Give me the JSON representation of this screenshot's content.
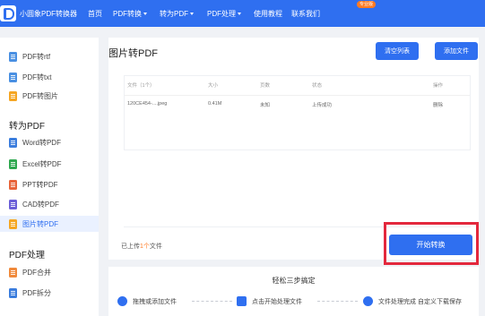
{
  "app": {
    "name": "小圆象PDF转换器",
    "pro_badge": "专业版"
  },
  "nav": {
    "home": "首页",
    "pdf_convert": "PDF转换",
    "to_pdf": "转为PDF",
    "pdf_process": "PDF处理",
    "tutorial": "使用教程",
    "contact": "联系我们"
  },
  "sidebar": {
    "items_top": [
      {
        "label": "PDF转rtf",
        "color": "#4a90e2"
      },
      {
        "label": "PDF转txt",
        "color": "#4a90e2"
      },
      {
        "label": "PDF转图片",
        "color": "#f5a623"
      }
    ],
    "section_to_pdf": "转为PDF",
    "items_to_pdf": [
      {
        "label": "Word转PDF",
        "color": "#3b7ddd"
      },
      {
        "label": "Excel转PDF",
        "color": "#2fa84f"
      },
      {
        "label": "PPT转PDF",
        "color": "#e8643a"
      },
      {
        "label": "CAD转PDF",
        "color": "#6b5fd8"
      },
      {
        "label": "图片转PDF",
        "color": "#f5a623"
      }
    ],
    "section_pdf_process": "PDF处理",
    "items_pdf_process": [
      {
        "label": "PDF合并",
        "color": "#f08a3c"
      },
      {
        "label": "PDF拆分",
        "color": "#3b7ddd"
      }
    ]
  },
  "main": {
    "title": "图片转PDF",
    "clear_button": "清空列表",
    "add_button": "添加文件",
    "columns": {
      "file": "文件（1个）",
      "size": "大小",
      "pages": "页数",
      "status": "状态",
      "action": "操作"
    },
    "rows": [
      {
        "file": "120CE454-....jpeg",
        "size": "0.41M",
        "pages": "未知",
        "status": "上传成功",
        "action": "删除"
      }
    ],
    "upload_prefix": "已上传",
    "upload_count": "1个",
    "upload_suffix": "文件",
    "start_button": "开始转换"
  },
  "steps": {
    "title": "轻松三步搞定",
    "items": [
      {
        "label": "拖拽或添加文件"
      },
      {
        "label": "点击开始处理文件"
      },
      {
        "label": "文件处理完成 自定义下载保存"
      }
    ]
  },
  "colors": {
    "accent": "#2f6ff0",
    "highlight": "#e3283d",
    "badge": "#ff7a22"
  }
}
